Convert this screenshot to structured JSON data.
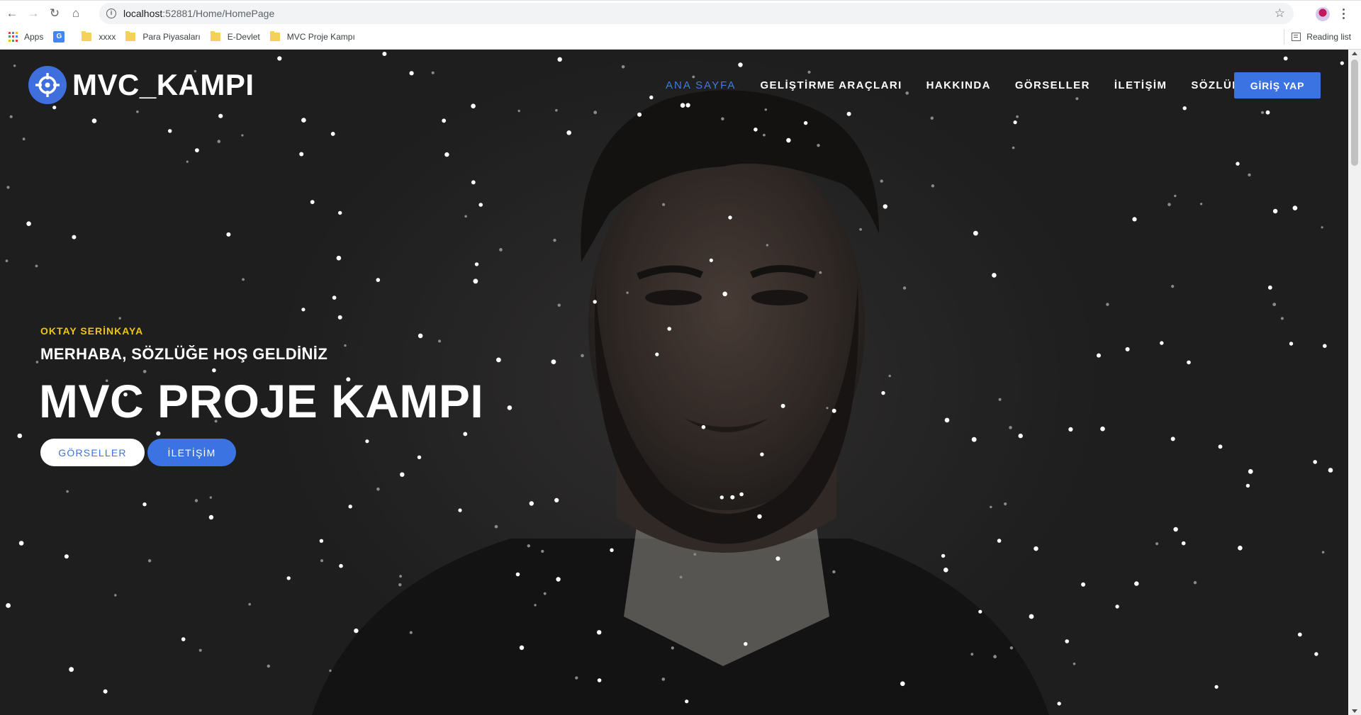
{
  "browser": {
    "url_host": "localhost",
    "url_rest": ":52881/Home/HomePage",
    "bookmarks": [
      {
        "label": "Apps",
        "icon": "apps-grid-icon"
      },
      {
        "label": "",
        "icon": "google-translate-icon"
      },
      {
        "label": "xxxx",
        "icon": "folder-icon"
      },
      {
        "label": "Para Piyasaları",
        "icon": "folder-icon"
      },
      {
        "label": "E-Devlet",
        "icon": "folder-icon"
      },
      {
        "label": "MVC Proje Kampı",
        "icon": "folder-icon"
      }
    ],
    "reading_list": "Reading list"
  },
  "site": {
    "logo_text": "MVC_KAMPI",
    "nav": [
      {
        "label": "ANA SAYFA",
        "active": true
      },
      {
        "label": "GELİŞTİRME ARAÇLARI",
        "active": false
      },
      {
        "label": "HAKKINDA",
        "active": false
      },
      {
        "label": "GÖRSELLER",
        "active": false
      },
      {
        "label": "İLETİŞİM",
        "active": false
      },
      {
        "label": "SÖZLÜK",
        "active": false
      }
    ],
    "login_label": "GİRİŞ YAP"
  },
  "hero": {
    "author": "OKTAY SERİNKAYA",
    "subtitle": "MERHABA, SÖZLÜĞE HOŞ GELDİNİZ",
    "title": "MVC PROJE KAMPI",
    "button_primary": "GÖRSELLER",
    "button_secondary": "İLETİŞİM"
  },
  "colors": {
    "accent": "#3b73e3",
    "author_yellow": "#f0c419",
    "background": "#232323"
  }
}
